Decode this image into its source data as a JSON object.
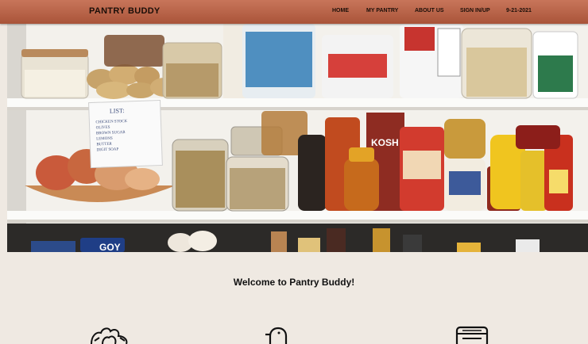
{
  "header": {
    "brand": "PANTRY BUDDY",
    "nav": {
      "home": "HOME",
      "my_pantry": "MY PANTRY",
      "about_us": "ABOUT US",
      "sign": "SIGN IN/UP",
      "date": "9-21-2021"
    }
  },
  "hero": {
    "note": {
      "title": "LIST:",
      "lines": [
        "CHICKEN STOCK",
        "OLIVES",
        "BROWN SUGAR",
        "LEMONS",
        "BUTTER",
        "DIGIT SOAP"
      ]
    },
    "labels": {
      "kosher": "KOSH",
      "goya": "GOY"
    }
  },
  "main": {
    "welcome": "Welcome to Pantry Buddy!"
  },
  "features": [
    {
      "icon": "vegetables-icon"
    },
    {
      "icon": "duck-icon"
    },
    {
      "icon": "oven-icon"
    }
  ],
  "colors": {
    "header": "#b45f43",
    "background": "#efe9e2",
    "text": "#1a0e08"
  }
}
